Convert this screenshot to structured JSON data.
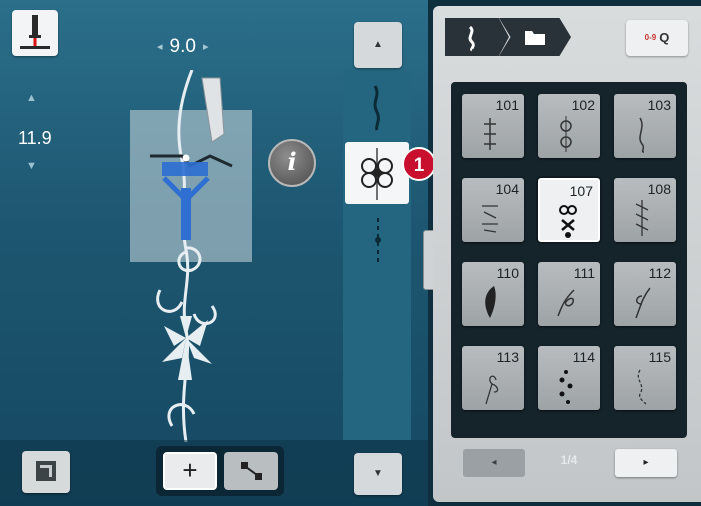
{
  "stitch_width": "9.0",
  "stitch_length": "11.9",
  "info_label": "i",
  "callout_number": "1",
  "breadcrumb": [
    "embroidery-stitch-category",
    "folder"
  ],
  "search_label": "Q",
  "search_prefix": "0-9",
  "stitch_grid": [
    {
      "number": "101",
      "selected": false
    },
    {
      "number": "102",
      "selected": false
    },
    {
      "number": "103",
      "selected": false
    },
    {
      "number": "104",
      "selected": false
    },
    {
      "number": "107",
      "selected": true
    },
    {
      "number": "108",
      "selected": false
    },
    {
      "number": "110",
      "selected": false
    },
    {
      "number": "111",
      "selected": false
    },
    {
      "number": "112",
      "selected": false
    },
    {
      "number": "113",
      "selected": false
    },
    {
      "number": "114",
      "selected": false
    },
    {
      "number": "115",
      "selected": false
    }
  ],
  "page_indicator": "1/4",
  "page_prev_label": "◂",
  "page_next_label": "▸",
  "colors": {
    "accent_badge": "#c8102e",
    "panel_blue": "#1d5670"
  }
}
